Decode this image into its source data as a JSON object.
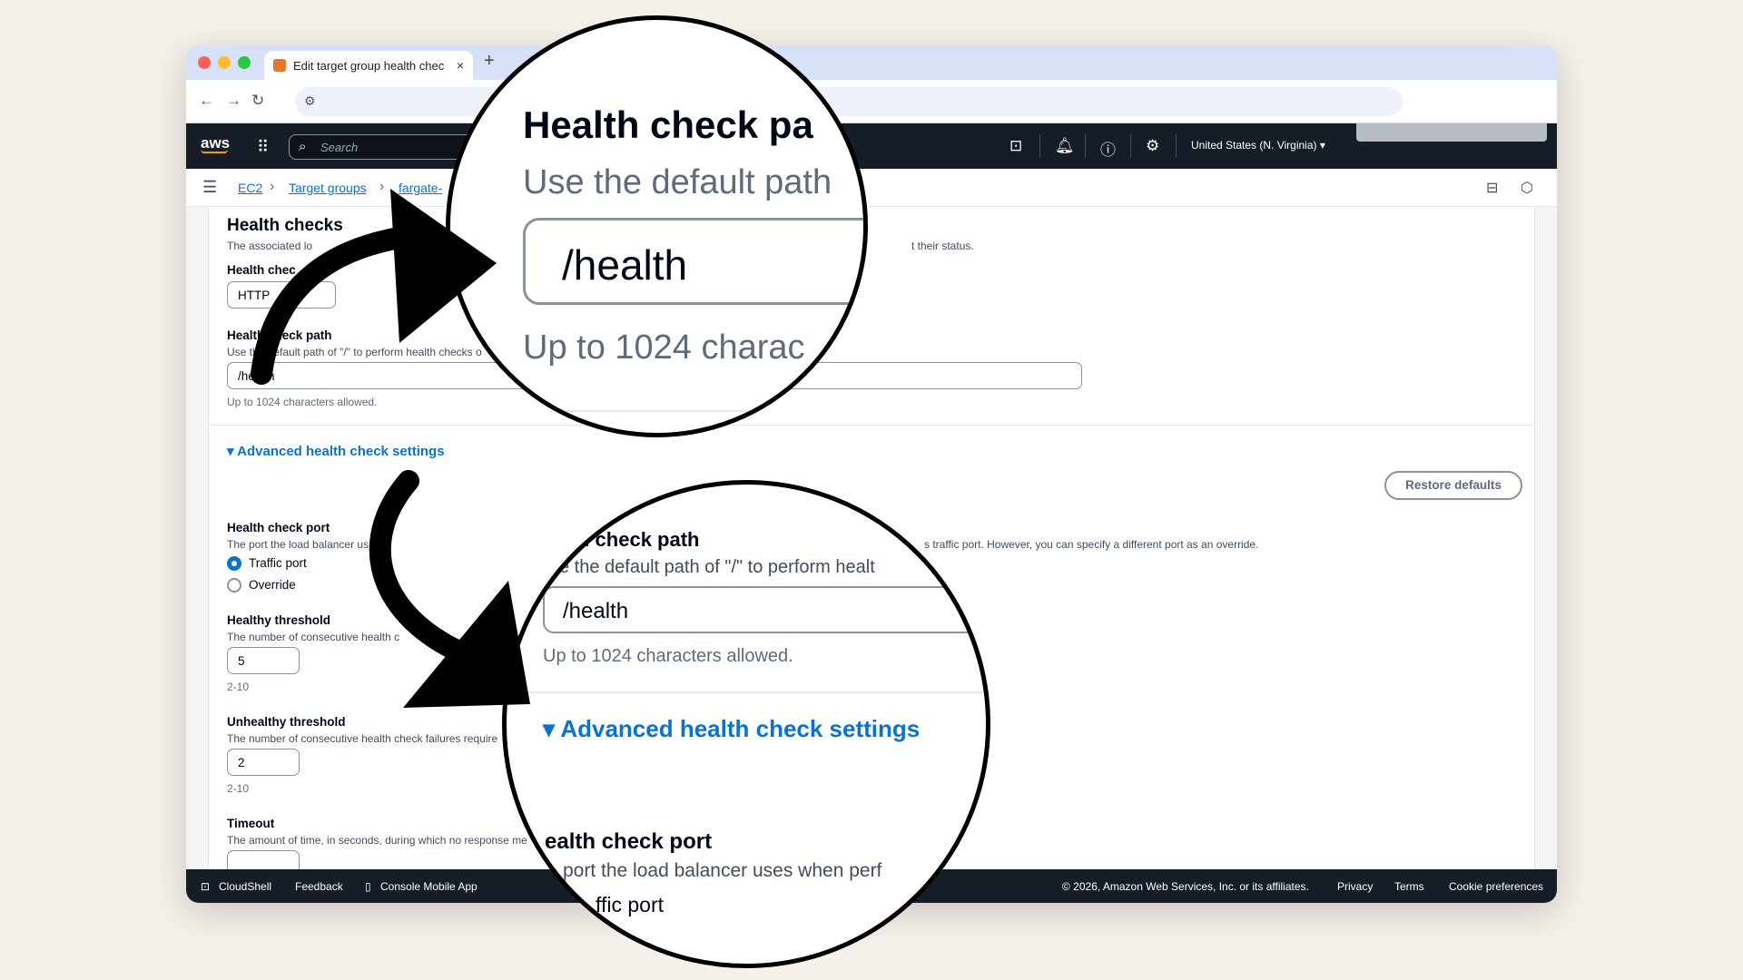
{
  "browser": {
    "tab_title": "Edit target group health chec",
    "tab_close": "×",
    "new_tab": "+"
  },
  "aws_header": {
    "logo": "aws",
    "search_placeholder": "Search",
    "region": "United States (N. Virginia) ▾"
  },
  "breadcrumb": [
    "EC2",
    "Target groups",
    "fargate-"
  ],
  "health_checks": {
    "title": "Health checks",
    "description_left": "The associated lo",
    "description_right": "t their status.",
    "protocol_label": "Health chec",
    "protocol_value": "HTTP",
    "path_label": "Health check path",
    "path_description": "Use the default path of \"/\" to perform health checks o",
    "path_value": "/health",
    "path_hint": "Up to 1024 characters allowed."
  },
  "advanced": {
    "toggle_label": "Advanced health check settings",
    "restore_defaults": "Restore defaults",
    "port_label": "Health check port",
    "port_description_left": "The port the load balancer us",
    "port_description_right": "s traffic port. However, you can specify a different port as an override.",
    "port_options": [
      "Traffic port",
      "Override"
    ],
    "healthy_label": "Healthy threshold",
    "healthy_description": "The number of consecutive health c",
    "healthy_value": "5",
    "healthy_range": "2-10",
    "unhealthy_label": "Unhealthy threshold",
    "unhealthy_description": "The number of consecutive health check failures require",
    "unhealthy_value": "2",
    "unhealthy_range": "2-10",
    "timeout_label": "Timeout",
    "timeout_description": "The amount of time, in seconds, during which no response me"
  },
  "footer": {
    "cloudshell": "CloudShell",
    "feedback": "Feedback",
    "mobile_app": "Console Mobile App",
    "copyright": "© 2026, Amazon Web Services, Inc. or its affiliates.",
    "privacy": "Privacy",
    "terms": "Terms",
    "cookies": "Cookie preferences"
  },
  "zoom1": {
    "title": "Health check pa",
    "subtitle": "Use the default path",
    "value": "/health",
    "hint": "Up to 1024 charac"
  },
  "zoom2": {
    "path_label": "h check path",
    "path_description": "e the default path of \"/\" to perform healt",
    "value": "/health",
    "hint": "Up to 1024 characters allowed.",
    "toggle_label": "Advanced health check settings",
    "port_label": "ealth check port",
    "port_description": "port the load balancer uses when perf",
    "option": "ffic port"
  }
}
